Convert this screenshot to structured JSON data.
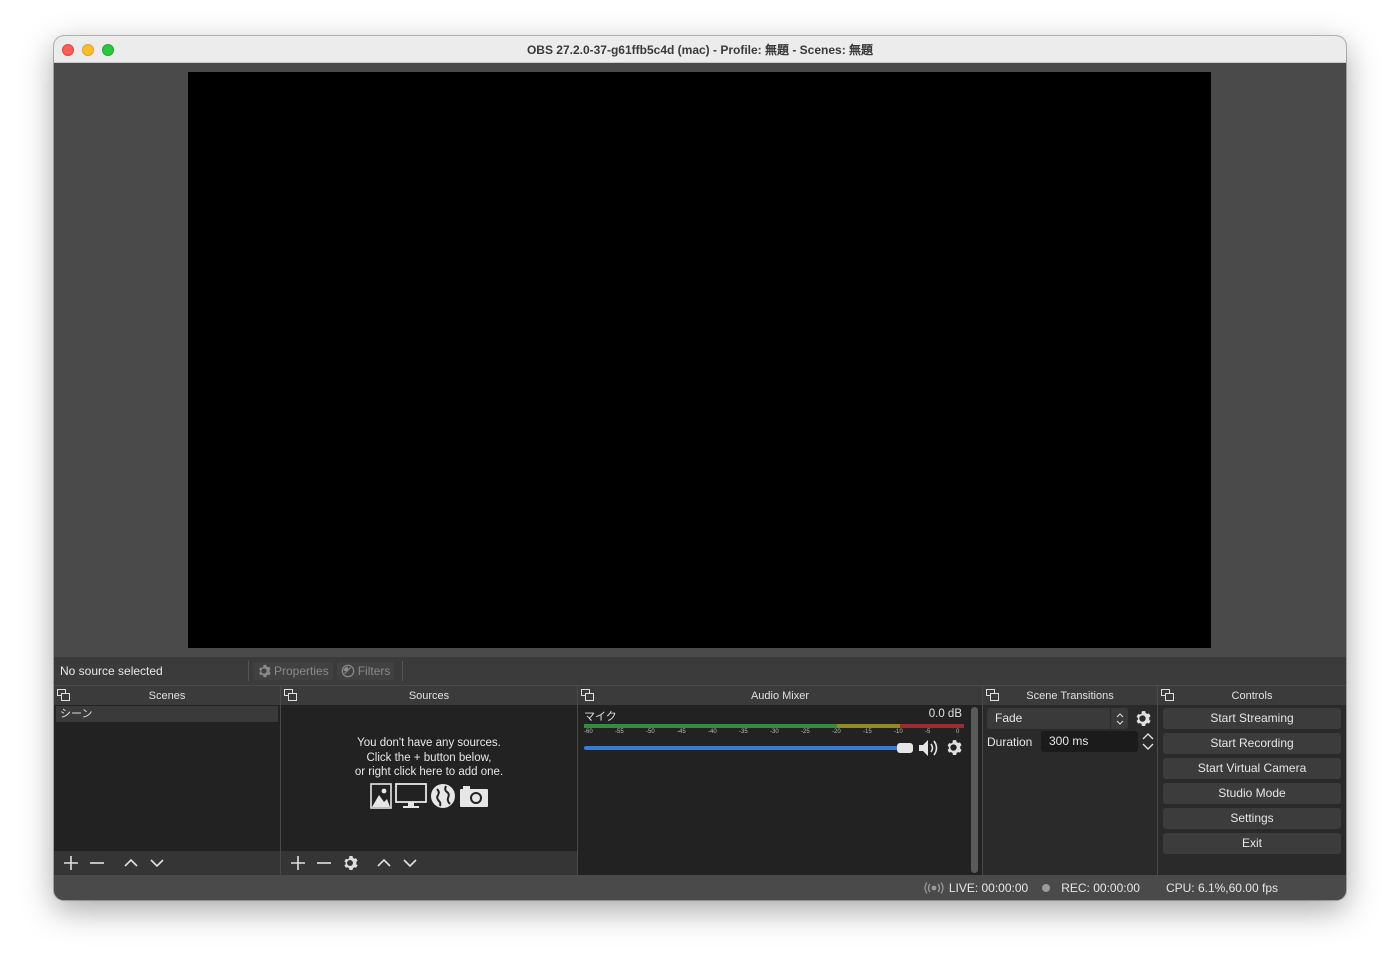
{
  "window": {
    "title": "OBS 27.2.0-37-g61ffb5c4d (mac) - Profile: 無題 - Scenes: 無題"
  },
  "source_toolbar": {
    "no_source": "No source selected",
    "properties_label": "Properties",
    "filters_label": "Filters"
  },
  "docks": {
    "scenes": {
      "title": "Scenes",
      "items": [
        {
          "label": "シーン"
        }
      ]
    },
    "sources": {
      "title": "Sources",
      "empty_line1": "You don't have any sources.",
      "empty_line2": "Click the + button below,",
      "empty_line3": "or right click here to add one.",
      "empty_icons": [
        "image-icon",
        "display-icon",
        "browser-icon",
        "camera-icon"
      ]
    },
    "audio_mixer": {
      "title": "Audio Mixer",
      "track_name": "マイク",
      "track_db": "0.0 dB",
      "volume_fraction": 0.98,
      "ticks": [
        "-60",
        "-55",
        "-50",
        "-45",
        "-40",
        "-35",
        "-30",
        "-25",
        "-20",
        "-15",
        "-10",
        "-5",
        "0"
      ]
    },
    "scene_transitions": {
      "title": "Scene Transitions",
      "selected": "Fade",
      "duration_label": "Duration",
      "duration_value": "300 ms"
    },
    "controls": {
      "title": "Controls",
      "buttons": [
        "Start Streaming",
        "Start Recording",
        "Start Virtual Camera",
        "Studio Mode",
        "Settings",
        "Exit"
      ]
    }
  },
  "statusbar": {
    "live": "LIVE: 00:00:00",
    "rec": "REC: 00:00:00",
    "cpu": "CPU: 6.1%,60.00 fps"
  },
  "colors": {
    "accent": "#3a7bd5",
    "meter_green": "#3a8a3a",
    "meter_yellow": "#8f8a2a",
    "meter_red": "#9a2d2d"
  }
}
